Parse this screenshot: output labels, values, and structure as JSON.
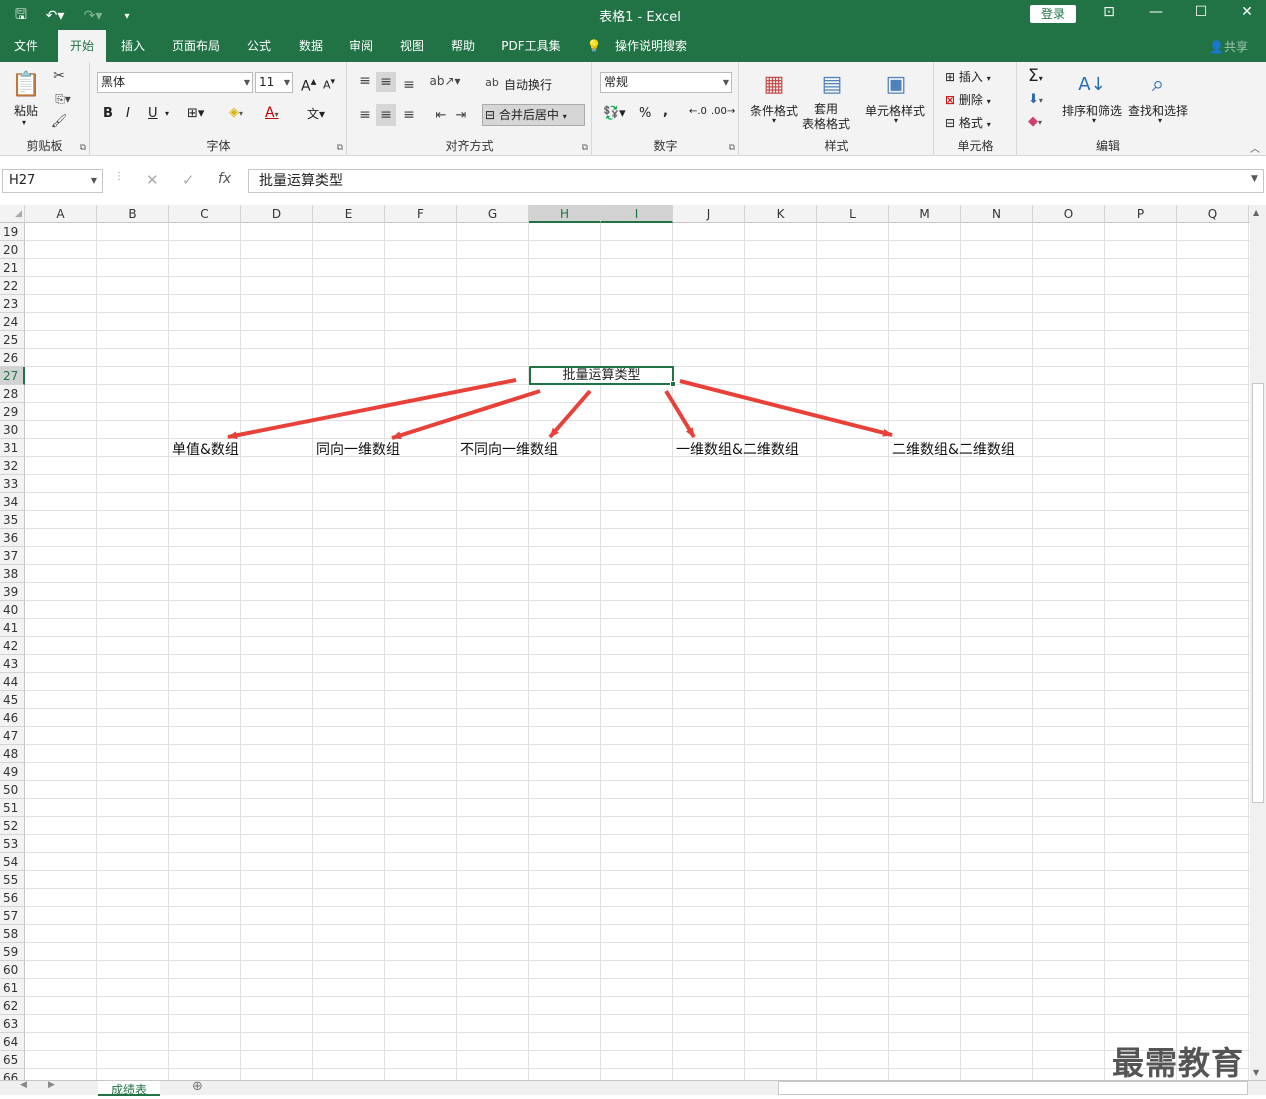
{
  "window": {
    "title": "表格1  -  Excel",
    "login": "登录",
    "qat": {
      "save": "🖫",
      "undo": "↶▾",
      "redo": "↷▾",
      "more": "▾"
    },
    "controls": {
      "ribbon_opts": "⊡",
      "minimize": "—",
      "maximize": "☐",
      "close": "✕"
    }
  },
  "tabs": [
    "文件",
    "开始",
    "插入",
    "页面布局",
    "公式",
    "数据",
    "审阅",
    "视图",
    "帮助",
    "PDF工具集"
  ],
  "tell_me": "操作说明搜索",
  "share": "共享",
  "ribbon": {
    "clipboard": {
      "label": "剪贴板",
      "paste": "粘贴"
    },
    "font": {
      "label": "字体",
      "font_name": "黑体",
      "font_size": "11",
      "bold": "B",
      "italic": "I",
      "underline": "U",
      "grow": "A",
      "shrink": "A"
    },
    "alignment": {
      "label": "对齐方式",
      "wrap": "自动换行",
      "merge": "合并后居中"
    },
    "number": {
      "label": "数字",
      "format": "常规",
      "percent": "%",
      "comma": ","
    },
    "styles": {
      "label": "样式",
      "conditional": "条件格式",
      "table_format": "套用\n表格格式",
      "cell_styles": "单元格样式"
    },
    "cells": {
      "label": "单元格",
      "insert": "插入",
      "delete": "删除",
      "format": "格式"
    },
    "editing": {
      "label": "编辑",
      "sort": "排序和筛选",
      "find": "查找和选择"
    }
  },
  "formula_bar": {
    "name_box": "H27",
    "cancel": "✕",
    "enter": "✓",
    "fx": "fx",
    "content": "批量运算类型"
  },
  "columns": [
    "A",
    "B",
    "C",
    "D",
    "E",
    "F",
    "G",
    "H",
    "I",
    "J",
    "K",
    "L",
    "M",
    "N",
    "O",
    "P",
    "Q"
  ],
  "selected_columns": [
    "H",
    "I"
  ],
  "rows": [
    19,
    20,
    21,
    22,
    23,
    24,
    25,
    26,
    27,
    28,
    29,
    30,
    31,
    32,
    33,
    34,
    35,
    36,
    37,
    38,
    39,
    40,
    41,
    42,
    43,
    44,
    45,
    46,
    47,
    48,
    49,
    50,
    51,
    52,
    53,
    54,
    55,
    56,
    57,
    58,
    59,
    60,
    61,
    62,
    63,
    64,
    65,
    66
  ],
  "selected_row": 27,
  "cells": {
    "root": "批量运算类型",
    "c31": "单值&数组",
    "e31": "同向一维数组",
    "g31": "不同向一维数组",
    "j31": "一维数组&二维数组",
    "m31": "二维数组&二维数组"
  },
  "arrow_color": "#e8413a",
  "sheet_tab": "成绩表",
  "watermark": "最需教育"
}
